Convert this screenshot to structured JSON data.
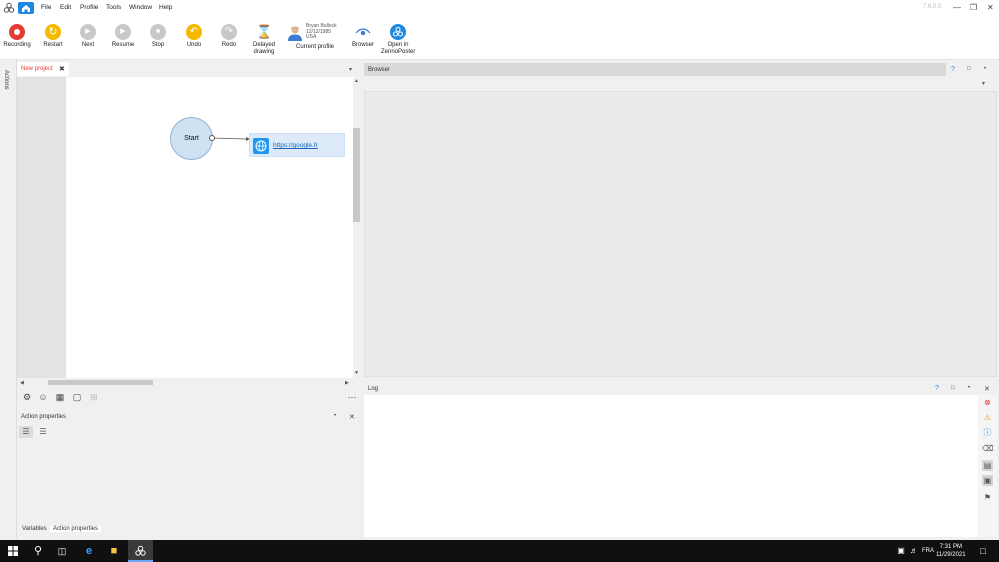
{
  "menubar": {
    "items": [
      "File",
      "Edit",
      "Profile",
      "Tools",
      "Window",
      "Help"
    ],
    "version": "7.6.0.0"
  },
  "toolbar": {
    "buttons": [
      {
        "label": "Recording",
        "color": "#e53935"
      },
      {
        "label": "Restart",
        "color": "#f5b800"
      },
      {
        "label": "Next",
        "color": "#c8c8c8"
      },
      {
        "label": "Resume",
        "color": "#c8c8c8"
      },
      {
        "label": "Stop",
        "color": "#c8c8c8"
      },
      {
        "label": "Undo",
        "color": "#f5b800"
      },
      {
        "label": "Redo",
        "color": "#c8c8c8"
      },
      {
        "label": "Delayed drawing",
        "color": "#c8a040"
      }
    ],
    "profile": {
      "name": "Bryan Bullock",
      "date": "12/12/1985",
      "country": "USA",
      "label": "Current profile"
    },
    "browser_label": "Browser",
    "open_label": "Open in ZennoPoster"
  },
  "left_strip": {
    "label": "Actions"
  },
  "project": {
    "tab_label": "New project",
    "start_label": "Start",
    "action_url": "https://google.fr"
  },
  "action_properties": {
    "title": "Action properties",
    "tabs": [
      "Variables",
      "Action properties"
    ]
  },
  "browser": {
    "title": "Browser"
  },
  "log": {
    "title": "Log"
  },
  "taskbar": {
    "lang": "FRA",
    "time": "7:31 PM",
    "date": "11/29/2021"
  },
  "colors": {
    "accent": "#1e88e5",
    "start_node": "#cfe2f3",
    "action_node": "#dcebf7"
  }
}
